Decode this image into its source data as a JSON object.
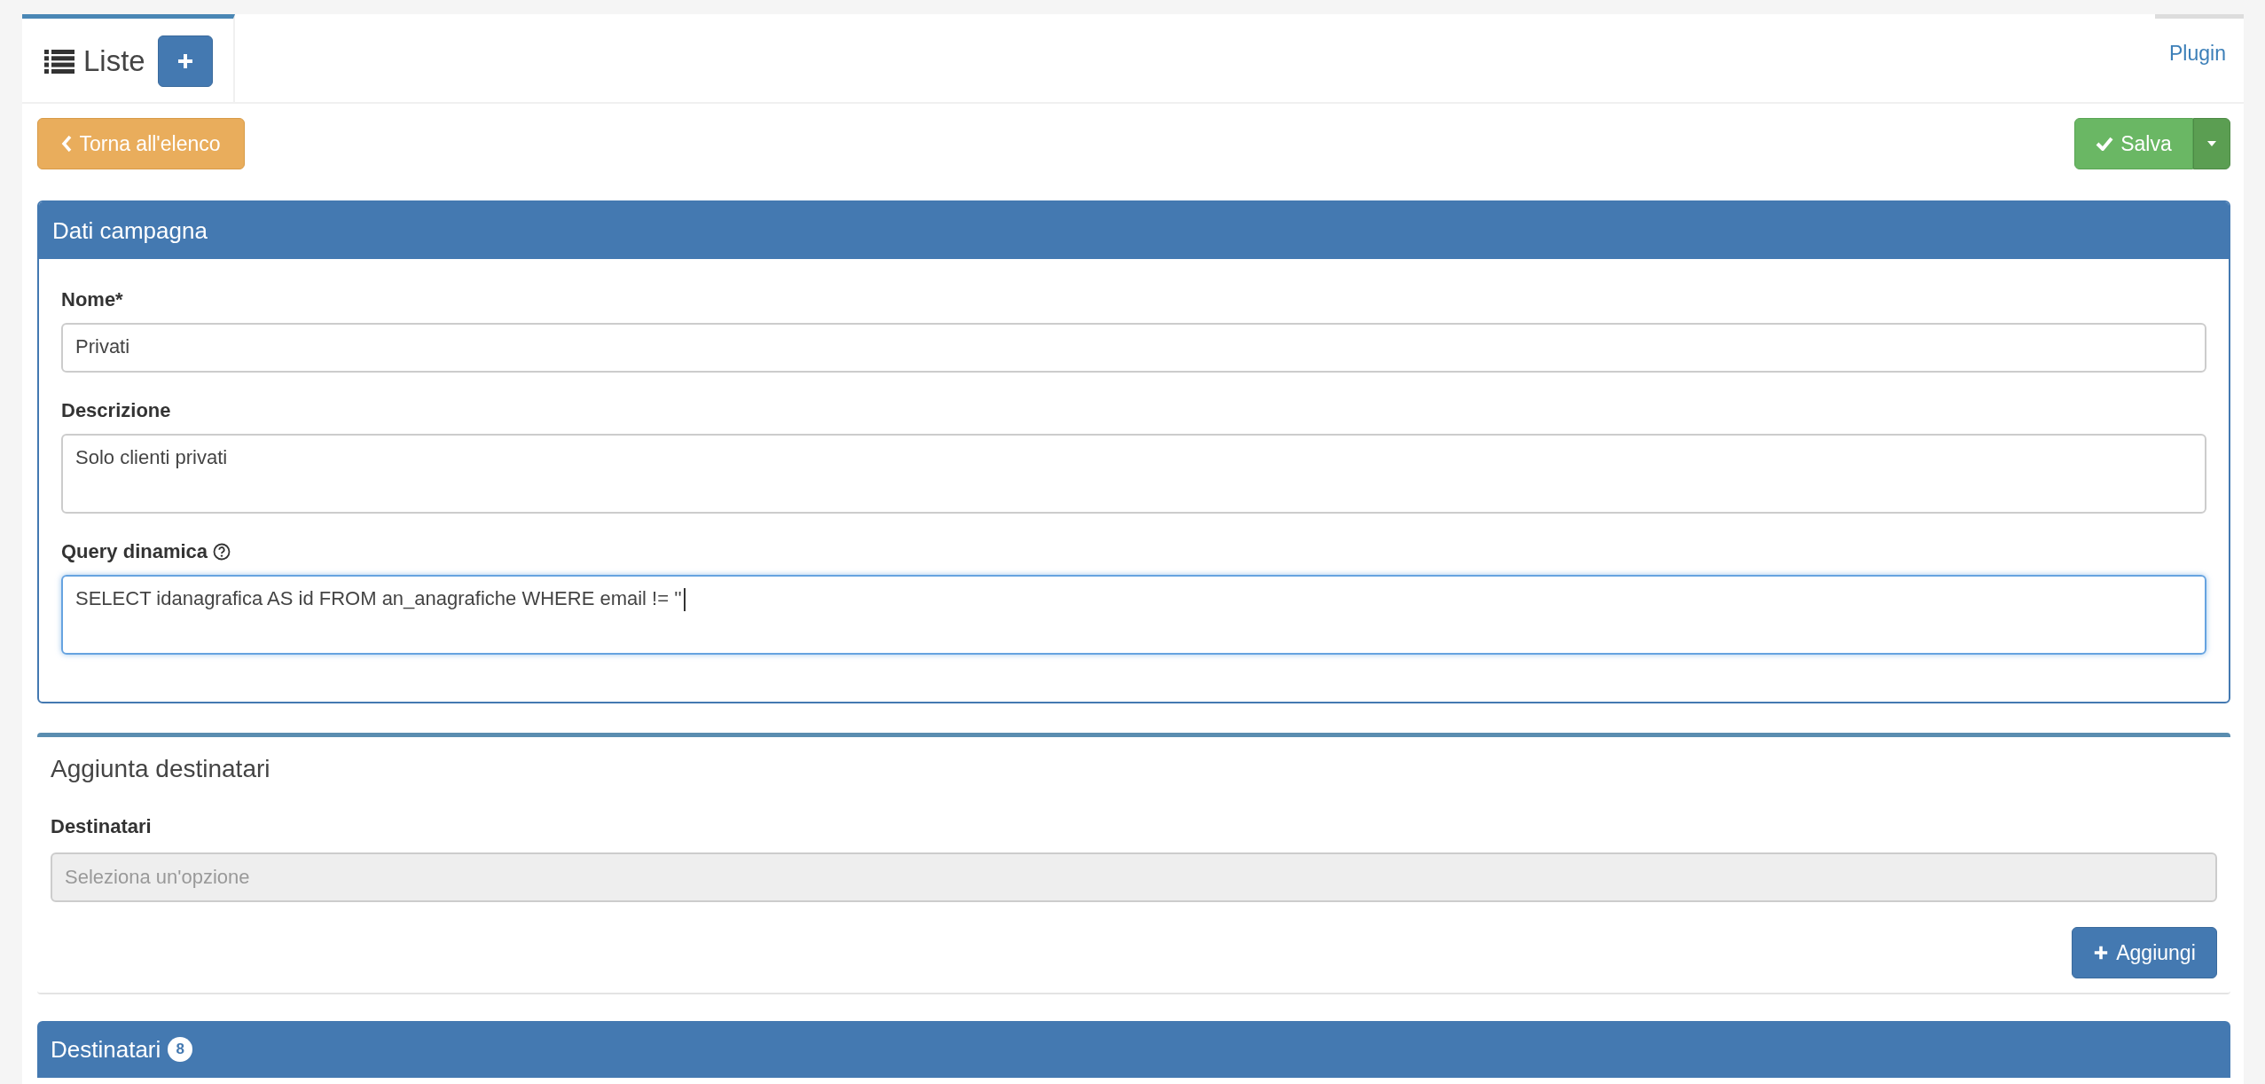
{
  "tabs": [
    {
      "label": "Liste",
      "selected": true,
      "kind": "main"
    },
    {
      "label": "Plugin",
      "selected": false,
      "kind": "link"
    }
  ],
  "toolbar": {
    "back_button": "Torna all'elenco",
    "save_button": "Salva"
  },
  "campaign_panel": {
    "title": "Dati campagna",
    "fields": [
      {
        "kind": "input",
        "label": "Nome*",
        "value": "Privati",
        "help": false,
        "focused": false
      },
      {
        "kind": "textarea",
        "label": "Descrizione",
        "value": "Solo clienti privati",
        "help": false,
        "focused": false
      },
      {
        "kind": "textarea",
        "label": "Query dinamica",
        "value": "SELECT idanagrafica AS id FROM an_anagrafiche WHERE email != ''",
        "help": true,
        "focused": true
      }
    ]
  },
  "add_box": {
    "title": "Aggiunta destinatari",
    "field_label": "Destinatari",
    "placeholder": "Seleziona un'opzione",
    "disabled": true,
    "button": "Aggiungi"
  },
  "recipients_panel": {
    "title": "Destinatari",
    "badge": "8"
  }
}
